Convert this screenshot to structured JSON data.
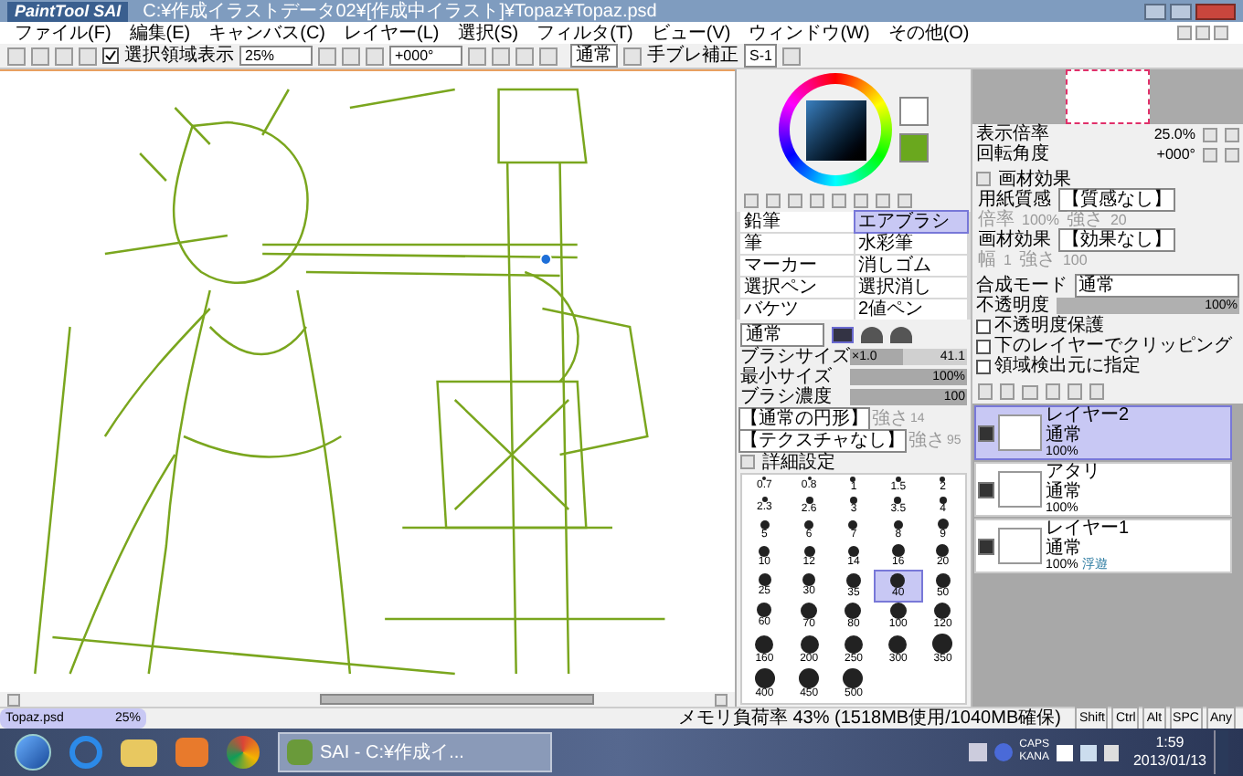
{
  "title_bar": {
    "app": "PaintTool SAI",
    "path": "C:¥作成イラストデータ02¥[作成中イラスト]¥Topaz¥Topaz.psd"
  },
  "menu": [
    "ファイル(F)",
    "編集(E)",
    "キャンバス(C)",
    "レイヤー(L)",
    "選択(S)",
    "フィルタ(T)",
    "ビュー(V)",
    "ウィンドウ(W)",
    "その他(O)"
  ],
  "toolbar": {
    "show_selection": {
      "label": "選択領域表示",
      "checked": true
    },
    "zoom": "25%",
    "angle": "+000°",
    "mode": "通常",
    "stabilizer_label": "手ブレ補正",
    "stabilizer": "S-1"
  },
  "tools": [
    {
      "label": "鉛筆",
      "selected": false
    },
    {
      "label": "エアブラシ",
      "selected": true
    },
    {
      "label": "筆",
      "selected": false
    },
    {
      "label": "水彩筆",
      "selected": false
    },
    {
      "label": "マーカー",
      "selected": false
    },
    {
      "label": "消しゴム",
      "selected": false
    },
    {
      "label": "選択ペン",
      "selected": false
    },
    {
      "label": "選択消し",
      "selected": false
    },
    {
      "label": "バケツ",
      "selected": false
    },
    {
      "label": "2値ペン",
      "selected": false
    }
  ],
  "brush": {
    "blend": "通常",
    "settings": [
      {
        "label": "ブラシサイズ",
        "multiplier": "×1.0",
        "value": "41.1",
        "level": 0.45
      },
      {
        "label": "最小サイズ",
        "value": "100%",
        "level": 1
      },
      {
        "label": "ブラシ濃度",
        "value": "100",
        "level": 1
      }
    ],
    "shapes": [
      {
        "value": "【通常の円形】",
        "strength_label": "強さ",
        "strength": "14"
      },
      {
        "value": "【テクスチャなし】",
        "strength_label": "強さ",
        "strength": "95"
      }
    ],
    "detail_label": "詳細設定"
  },
  "brush_sizes": [
    {
      "label": "0.7",
      "selected": false
    },
    {
      "label": "0.8",
      "selected": false
    },
    {
      "label": "1",
      "selected": false
    },
    {
      "label": "1.5",
      "selected": false
    },
    {
      "label": "2",
      "selected": false
    },
    {
      "label": "2.3",
      "selected": false
    },
    {
      "label": "2.6",
      "selected": false
    },
    {
      "label": "3",
      "selected": false
    },
    {
      "label": "3.5",
      "selected": false
    },
    {
      "label": "4",
      "selected": false
    },
    {
      "label": "5",
      "selected": false
    },
    {
      "label": "6",
      "selected": false
    },
    {
      "label": "7",
      "selected": false
    },
    {
      "label": "8",
      "selected": false
    },
    {
      "label": "9",
      "selected": false
    },
    {
      "label": "10",
      "selected": false
    },
    {
      "label": "12",
      "selected": false
    },
    {
      "label": "14",
      "selected": false
    },
    {
      "label": "16",
      "selected": false
    },
    {
      "label": "20",
      "selected": false
    },
    {
      "label": "25",
      "selected": false
    },
    {
      "label": "30",
      "selected": false
    },
    {
      "label": "35",
      "selected": false
    },
    {
      "label": "40",
      "selected": true
    },
    {
      "label": "50",
      "selected": false
    },
    {
      "label": "60",
      "selected": false
    },
    {
      "label": "70",
      "selected": false
    },
    {
      "label": "80",
      "selected": false
    },
    {
      "label": "100",
      "selected": false
    },
    {
      "label": "120",
      "selected": false
    },
    {
      "label": "160",
      "selected": false
    },
    {
      "label": "200",
      "selected": false
    },
    {
      "label": "250",
      "selected": false
    },
    {
      "label": "300",
      "selected": false
    },
    {
      "label": "350",
      "selected": false
    },
    {
      "label": "400",
      "selected": false
    },
    {
      "label": "450",
      "selected": false
    },
    {
      "label": "500",
      "selected": false
    }
  ],
  "navigator": {
    "zoom_label": "表示倍率",
    "zoom": "25.0%",
    "angle_label": "回転角度",
    "angle": "+000°"
  },
  "paper": {
    "header": "画材効果",
    "rows": [
      {
        "label": "用紙質感",
        "value": "【質感なし】"
      },
      {
        "label": "倍率",
        "value": "100%",
        "label2": "強さ",
        "value2": "20"
      },
      {
        "label": "画材効果",
        "value": "【効果なし】"
      },
      {
        "label": "幅",
        "value": "1",
        "label2": "強さ",
        "value2": "100"
      }
    ]
  },
  "layer_props": {
    "blend_label": "合成モード",
    "blend": "通常",
    "opacity_label": "不透明度",
    "opacity": "100%",
    "level": 1,
    "options": [
      {
        "label": "不透明度保護",
        "checked": false
      },
      {
        "label": "下のレイヤーでクリッピング",
        "checked": false
      },
      {
        "label": "領域検出元に指定",
        "checked": false
      }
    ]
  },
  "layers": [
    {
      "name": "レイヤー2",
      "mode": "通常",
      "opacity": "100%",
      "selected": true,
      "visible": true
    },
    {
      "name": "アタリ",
      "mode": "通常",
      "opacity": "100%",
      "selected": false,
      "visible": true
    },
    {
      "name": "レイヤー1",
      "mode": "通常",
      "opacity": "100%",
      "note": "浮遊",
      "selected": false,
      "visible": true
    }
  ],
  "document_tab": {
    "name": "Topaz.psd",
    "zoom": "25%"
  },
  "status": {
    "memory": "メモリ負荷率 43% (1518MB使用/1040MB確保)",
    "keys": [
      "Shift",
      "Ctrl",
      "Alt",
      "SPC",
      "Any"
    ]
  },
  "taskbar": {
    "window": "SAI - C:¥作成イ...",
    "tray_labels": [
      "CAPS",
      "KANA"
    ],
    "time": "1:59",
    "date": "2013/01/13"
  }
}
